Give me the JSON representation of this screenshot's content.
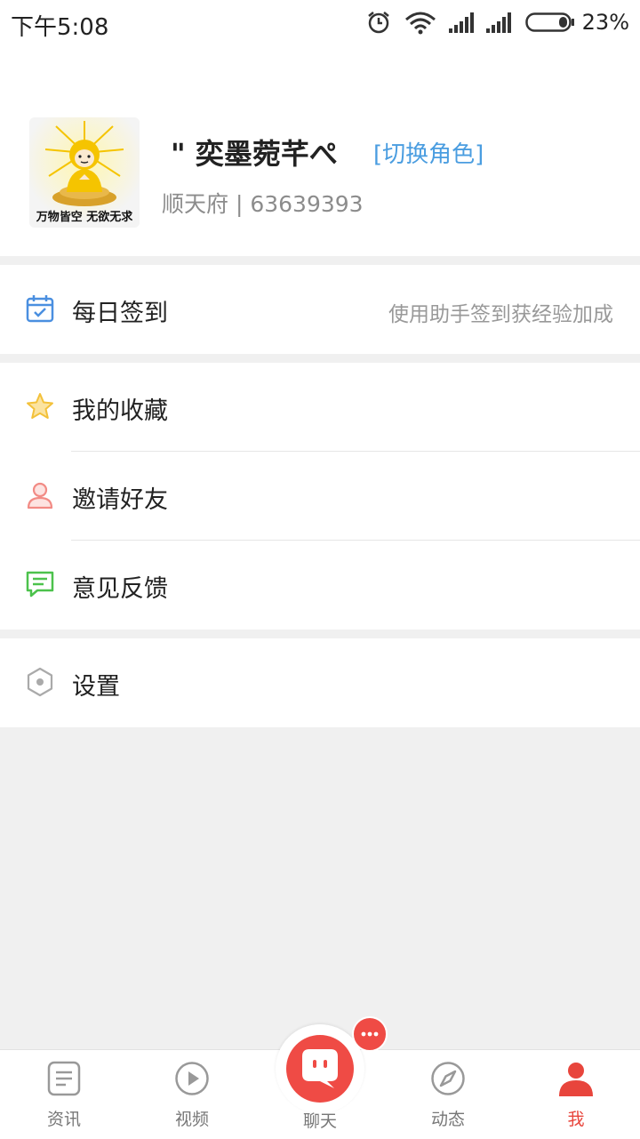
{
  "status_bar": {
    "time": "下午5:08",
    "battery": "23%"
  },
  "profile": {
    "username": "\" 奕墨菀芊ぺ",
    "switch_role": "[切换角色]",
    "subinfo": "顺天府 | 63639393",
    "avatar_caption": "万物皆空 无欲无求"
  },
  "menu": {
    "checkin": {
      "label": "每日签到",
      "hint": "使用助手签到获经验加成",
      "icon": "calendar-check-icon"
    },
    "favorites": {
      "label": "我的收藏",
      "icon": "star-icon"
    },
    "invite": {
      "label": "邀请好友",
      "icon": "person-icon"
    },
    "feedback": {
      "label": "意见反馈",
      "icon": "chat-lines-icon"
    },
    "settings": {
      "label": "设置",
      "icon": "hexagon-gear-icon"
    }
  },
  "tabs": [
    {
      "label": "资讯",
      "icon": "news-icon"
    },
    {
      "label": "视频",
      "icon": "play-icon"
    },
    {
      "label": "聊天",
      "icon": "chat-icon"
    },
    {
      "label": "动态",
      "icon": "compass-icon"
    },
    {
      "label": "我",
      "icon": "user-icon",
      "active": true
    }
  ],
  "colors": {
    "accent": "#e8453c",
    "link": "#4a9de0",
    "checkin_icon": "#4a8fe0",
    "star": "#f3c13a",
    "invite_icon": "#f28b85",
    "feedback_icon": "#4cc24c"
  }
}
